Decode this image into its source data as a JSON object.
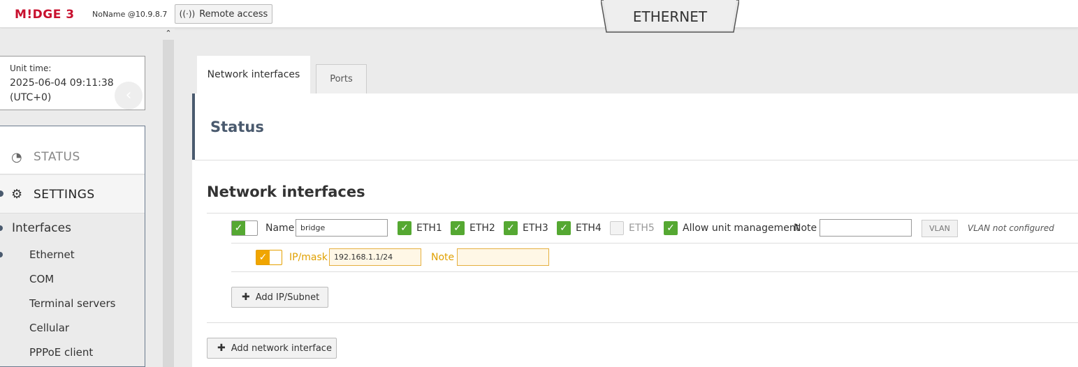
{
  "header": {
    "logo": "M!DGE 3",
    "unit_name": "NoName @10.9.8.7",
    "remote_access_label": "Remote access",
    "page_title": "ETHERNET"
  },
  "sidebar": {
    "unit_time_label": "Unit time:",
    "unit_time_value": "2025-06-04 09:11:38",
    "unit_time_tz": "(UTC+0)",
    "status_label": "STATUS",
    "settings_label": "SETTINGS",
    "interfaces_label": "Interfaces",
    "items": [
      "Ethernet",
      "COM",
      "Terminal servers",
      "Cellular",
      "PPPoE client"
    ]
  },
  "tabs": [
    "Network interfaces",
    "Ports"
  ],
  "status_title": "Status",
  "section_title": "Network interfaces",
  "interface": {
    "name_label": "Name",
    "name_value": "bridge",
    "ports": [
      {
        "label": "ETH1",
        "checked": true
      },
      {
        "label": "ETH2",
        "checked": true
      },
      {
        "label": "ETH3",
        "checked": true
      },
      {
        "label": "ETH4",
        "checked": true
      },
      {
        "label": "ETH5",
        "checked": false
      }
    ],
    "allow_mgmt_label": "Allow unit management",
    "note_label": "Note",
    "note_value": "",
    "vlan_label": "VLAN",
    "vlan_note": "VLAN not configured"
  },
  "ip_row": {
    "ip_label": "IP/mask",
    "ip_value": "192.168.1.1/24",
    "note_label": "Note",
    "note_value": ""
  },
  "buttons": {
    "add_ip_subnet": "Add IP/Subnet",
    "add_network_interface": "Add network interface"
  },
  "colors": {
    "brand": "#c8102e",
    "check_green": "#55a832",
    "ip_orange": "#f0a500",
    "nav_accent": "#4a5a6e"
  }
}
